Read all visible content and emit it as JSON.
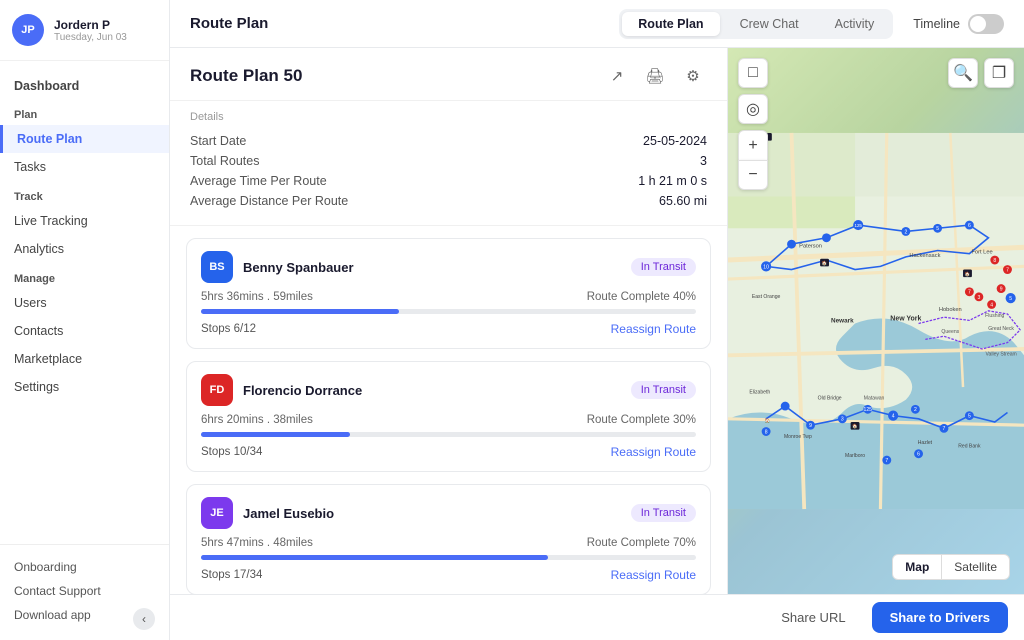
{
  "sidebar": {
    "user": {
      "initials": "JP",
      "name": "Jordern P",
      "date": "Tuesday, Jun 03"
    },
    "sections": [
      {
        "label": "Dashboard",
        "items": []
      },
      {
        "label": "Plan",
        "items": [
          {
            "id": "route-plan",
            "label": "Route Plan",
            "active": true
          },
          {
            "id": "tasks",
            "label": "Tasks",
            "active": false
          }
        ]
      },
      {
        "label": "Track",
        "items": [
          {
            "id": "live-tracking",
            "label": "Live Tracking",
            "active": false
          },
          {
            "id": "analytics",
            "label": "Analytics",
            "active": false
          }
        ]
      },
      {
        "label": "Manage",
        "items": [
          {
            "id": "users",
            "label": "Users",
            "active": false
          },
          {
            "id": "contacts",
            "label": "Contacts",
            "active": false
          },
          {
            "id": "marketplace",
            "label": "Marketplace",
            "active": false
          },
          {
            "id": "settings",
            "label": "Settings",
            "active": false
          }
        ]
      }
    ],
    "footer": [
      {
        "id": "onboarding",
        "label": "Onboarding"
      },
      {
        "id": "contact-support",
        "label": "Contact Support"
      },
      {
        "id": "download-app",
        "label": "Download app"
      }
    ]
  },
  "topnav": {
    "title": "Route Plan",
    "tabs": [
      {
        "id": "route-plan",
        "label": "Route Plan",
        "active": true
      },
      {
        "id": "crew-chat",
        "label": "Crew Chat",
        "active": false
      },
      {
        "id": "activity",
        "label": "Activity",
        "active": false
      }
    ],
    "timeline_label": "Timeline"
  },
  "plan": {
    "title": "Route Plan 50",
    "details_label": "Details",
    "start_date_label": "Start Date",
    "start_date_val": "25-05-2024",
    "total_routes_label": "Total Routes",
    "total_routes_val": "3",
    "avg_time_label": "Average Time Per Route",
    "avg_time_val": "1 h 21 m 0 s",
    "avg_dist_label": "Average Distance Per Route",
    "avg_dist_val": "65.60 mi"
  },
  "drivers": [
    {
      "id": "benny",
      "initials": "BS",
      "avatar_color": "#2563eb",
      "name": "Benny Spanbauer",
      "status": "In Transit",
      "time_dist": "5hrs 36mins . 59miles",
      "complete": "Route Complete 40%",
      "progress": 40,
      "stops": "Stops  6/12",
      "reassign": "Reassign Route"
    },
    {
      "id": "florencio",
      "initials": "FD",
      "avatar_color": "#dc2626",
      "name": "Florencio Dorrance",
      "status": "In Transit",
      "time_dist": "6hrs 20mins . 38miles",
      "complete": "Route Complete 30%",
      "progress": 30,
      "stops": "Stops  10/34",
      "reassign": "Reassign Route"
    },
    {
      "id": "jamel",
      "initials": "JE",
      "avatar_color": "#7c3aed",
      "name": "Jamel Eusebio",
      "status": "In Transit",
      "time_dist": "5hrs 47mins . 48miles",
      "complete": "Route Complete 70%",
      "progress": 70,
      "stops": "Stops  17/34",
      "reassign": "Reassign Route"
    }
  ],
  "map": {
    "type_map": "Map",
    "type_satellite": "Satellite"
  },
  "bottombar": {
    "share_url": "Share URL",
    "share_drivers": "Share to Drivers"
  }
}
